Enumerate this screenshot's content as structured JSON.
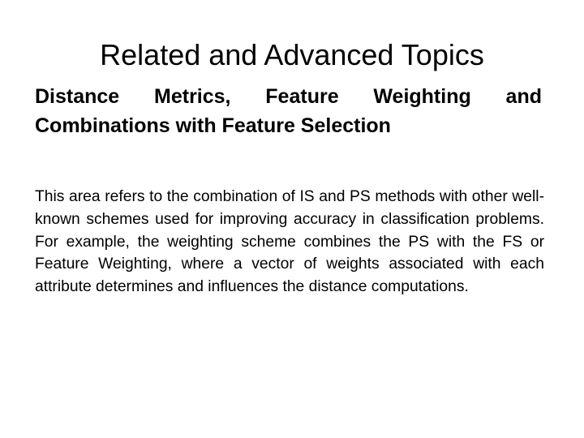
{
  "slide": {
    "title": "Related and Advanced Topics",
    "subtitle": "Distance Metrics, Feature Weighting and Combinations with Feature Selection",
    "body": "This area refers to the combination of IS and PS methods with other well-known schemes used for improving accuracy in classification problems. For example, the weighting scheme combines the PS with the FS or Feature Weighting, where a vector of weights associated with each attribute determines and influences the distance computations."
  }
}
